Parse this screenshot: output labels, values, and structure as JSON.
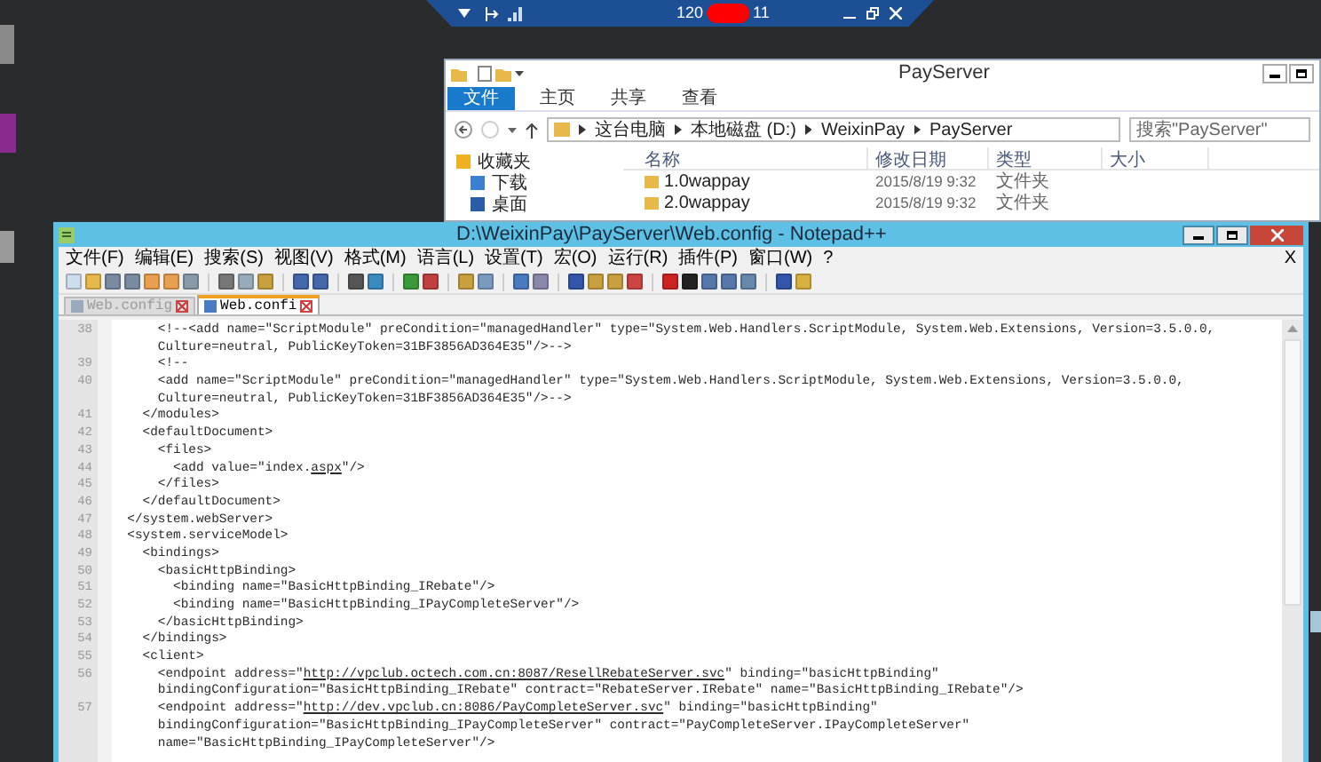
{
  "remote_bar": {
    "host_start": "120",
    "host_end": "11"
  },
  "explorer": {
    "title": "PayServer",
    "ribbon_tabs": [
      {
        "label": "文件",
        "selected": true
      },
      {
        "label": "主页",
        "selected": false
      },
      {
        "label": "共享",
        "selected": false
      },
      {
        "label": "查看",
        "selected": false
      }
    ],
    "breadcrumb": [
      "这台电脑",
      "本地磁盘 (D:)",
      "WeixinPay",
      "PayServer"
    ],
    "search": {
      "placeholder": "搜索\"PayServer\""
    },
    "columns": [
      "名称",
      "修改日期",
      "类型",
      "大小"
    ],
    "nav": [
      "收藏夹",
      "下载",
      "桌面"
    ],
    "files": [
      {
        "name": "1.0wappay",
        "modified": "2015/8/19 9:32",
        "type": "文件夹"
      },
      {
        "name": "2.0wappay",
        "modified": "2015/8/19 9:32",
        "type": "文件夹"
      }
    ]
  },
  "editor": {
    "title": "D:\\WeixinPay\\PayServer\\Web.config - Notepad++",
    "menu": [
      "文件(F)",
      "编辑(E)",
      "搜索(S)",
      "视图(V)",
      "格式(M)",
      "语言(L)",
      "设置(T)",
      "宏(O)",
      "运行(R)",
      "插件(P)",
      "窗口(W)",
      "?"
    ],
    "close_doc": "X",
    "tabs": [
      {
        "label": "Web.config",
        "selected": false
      },
      {
        "label": "Web.confi",
        "selected": true
      }
    ],
    "lines": [
      {
        "number": "38",
        "parts": [
          {
            "text": "      <!--<add name=\"ScriptModule\" preCondition=\"managedHandler\" type=\"System.Web.Handlers.ScriptModule, System.Web.Extensions, Version=3.5.0.0,",
            "underline": false
          }
        ]
      },
      {
        "parts": [
          {
            "text": "      Culture=neutral, PublicKeyToken=31BF3856AD364E35\"/>-->",
            "underline": false
          }
        ]
      },
      {
        "number": "39",
        "parts": [
          {
            "text": "      <!--",
            "underline": false
          }
        ]
      },
      {
        "number": "40",
        "parts": [
          {
            "text": "      <add name=\"ScriptModule\" preCondition=\"managedHandler\" type=\"System.Web.Handlers.ScriptModule, System.Web.Extensions, Version=3.5.0.0,",
            "underline": false
          }
        ]
      },
      {
        "parts": [
          {
            "text": "      Culture=neutral, PublicKeyToken=31BF3856AD364E35\"/>-->",
            "underline": false
          }
        ]
      },
      {
        "number": "41",
        "parts": [
          {
            "text": "    </modules>",
            "underline": false
          }
        ]
      },
      {
        "number": "42",
        "parts": [
          {
            "text": "    <defaultDocument>",
            "underline": false
          }
        ]
      },
      {
        "number": "43",
        "parts": [
          {
            "text": "      <files>",
            "underline": false
          }
        ]
      },
      {
        "number": "44",
        "parts": [
          {
            "text": "        <add value=\"index.",
            "underline": false
          },
          {
            "text": "aspx",
            "underline": true
          },
          {
            "text": "\"/>",
            "underline": false
          }
        ]
      },
      {
        "number": "45",
        "parts": [
          {
            "text": "      </files>",
            "underline": false
          }
        ]
      },
      {
        "number": "46",
        "parts": [
          {
            "text": "    </defaultDocument>",
            "underline": false
          }
        ]
      },
      {
        "number": "47",
        "parts": [
          {
            "text": "  </system.webServer>",
            "underline": false
          }
        ]
      },
      {
        "number": "48",
        "parts": [
          {
            "text": "  <system.serviceModel>",
            "underline": false
          }
        ]
      },
      {
        "number": "49",
        "parts": [
          {
            "text": "    <bindings>",
            "underline": false
          }
        ]
      },
      {
        "number": "50",
        "parts": [
          {
            "text": "      <basicHttpBinding>",
            "underline": false
          }
        ]
      },
      {
        "number": "51",
        "parts": [
          {
            "text": "        <binding name=\"BasicHttpBinding_IRebate\"/>",
            "underline": false
          }
        ]
      },
      {
        "number": "52",
        "parts": [
          {
            "text": "        <binding name=\"BasicHttpBinding_IPayCompleteServer\"/>",
            "underline": false
          }
        ]
      },
      {
        "number": "53",
        "parts": [
          {
            "text": "      </basicHttpBinding>",
            "underline": false
          }
        ]
      },
      {
        "number": "54",
        "parts": [
          {
            "text": "    </bindings>",
            "underline": false
          }
        ]
      },
      {
        "number": "55",
        "parts": [
          {
            "text": "    <client>",
            "underline": false
          }
        ]
      },
      {
        "number": "56",
        "parts": [
          {
            "text": "      <endpoint address=\"",
            "underline": false
          },
          {
            "text": "http://vpclub.octech.com.cn:8087/ResellRebateServer.svc",
            "underline": true
          },
          {
            "text": "\" binding=\"basicHttpBinding\"",
            "underline": false
          }
        ]
      },
      {
        "parts": [
          {
            "text": "      bindingConfiguration=\"BasicHttpBinding_IRebate\" contract=\"RebateServer.IRebate\" name=\"BasicHttpBinding_IRebate\"/>",
            "underline": false
          }
        ]
      },
      {
        "number": "57",
        "parts": [
          {
            "text": "      <endpoint address=\"",
            "underline": false
          },
          {
            "text": "http://dev.vpclub.cn:8086/PayCompleteServer.svc",
            "underline": true
          },
          {
            "text": "\" binding=\"basicHttpBinding\"",
            "underline": false
          }
        ]
      },
      {
        "parts": [
          {
            "text": "      bindingConfiguration=\"BasicHttpBinding_IPayCompleteServer\" contract=\"PayCompleteServer.IPayCompleteServer\"",
            "underline": false
          }
        ]
      },
      {
        "parts": [
          {
            "text": "      name=\"BasicHttpBinding_IPayCompleteServer\"/>",
            "underline": false
          }
        ]
      }
    ]
  }
}
